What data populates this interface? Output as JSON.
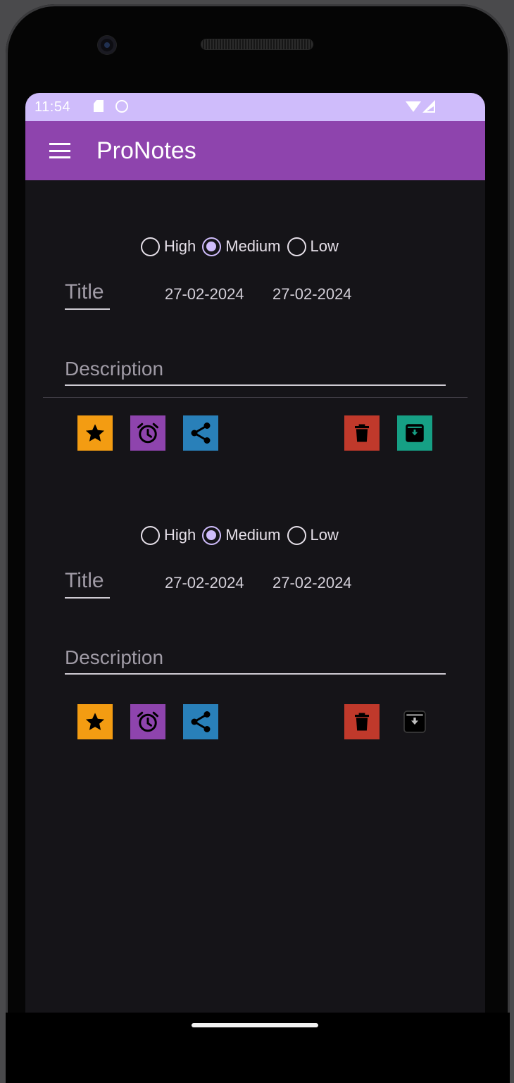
{
  "status_bar": {
    "time": "11:54",
    "icons": [
      "sd-card-icon",
      "circle-notification-icon",
      "wifi-icon",
      "signal-icon"
    ]
  },
  "app_bar": {
    "title": "ProNotes",
    "menu_icon": "hamburger-menu-icon"
  },
  "colors": {
    "status_bar": "#cfbcfb",
    "app_bar": "#8e44ad",
    "background": "#151418",
    "favorite": "#f39c12",
    "reminder": "#8e44ad",
    "share": "#2980b9",
    "delete": "#c0392b",
    "archive": "#16a085"
  },
  "notes": [
    {
      "priority_options": [
        {
          "label": "High",
          "checked": false
        },
        {
          "label": "Medium",
          "checked": true
        },
        {
          "label": "Low",
          "checked": false
        }
      ],
      "title_placeholder": "Title",
      "created_date": "27-02-2024",
      "modified_date": "27-02-2024",
      "description_placeholder": "Description",
      "actions": [
        "star-icon",
        "alarm-clock-icon",
        "share-icon",
        "trash-icon",
        "archive-icon"
      ]
    },
    {
      "priority_options": [
        {
          "label": "High",
          "checked": false
        },
        {
          "label": "Medium",
          "checked": true
        },
        {
          "label": "Low",
          "checked": false
        }
      ],
      "title_placeholder": "Title",
      "created_date": "27-02-2024",
      "modified_date": "27-02-2024",
      "description_placeholder": "Description",
      "actions": [
        "star-icon",
        "alarm-clock-icon",
        "share-icon",
        "trash-icon",
        "archive-icon"
      ]
    }
  ]
}
